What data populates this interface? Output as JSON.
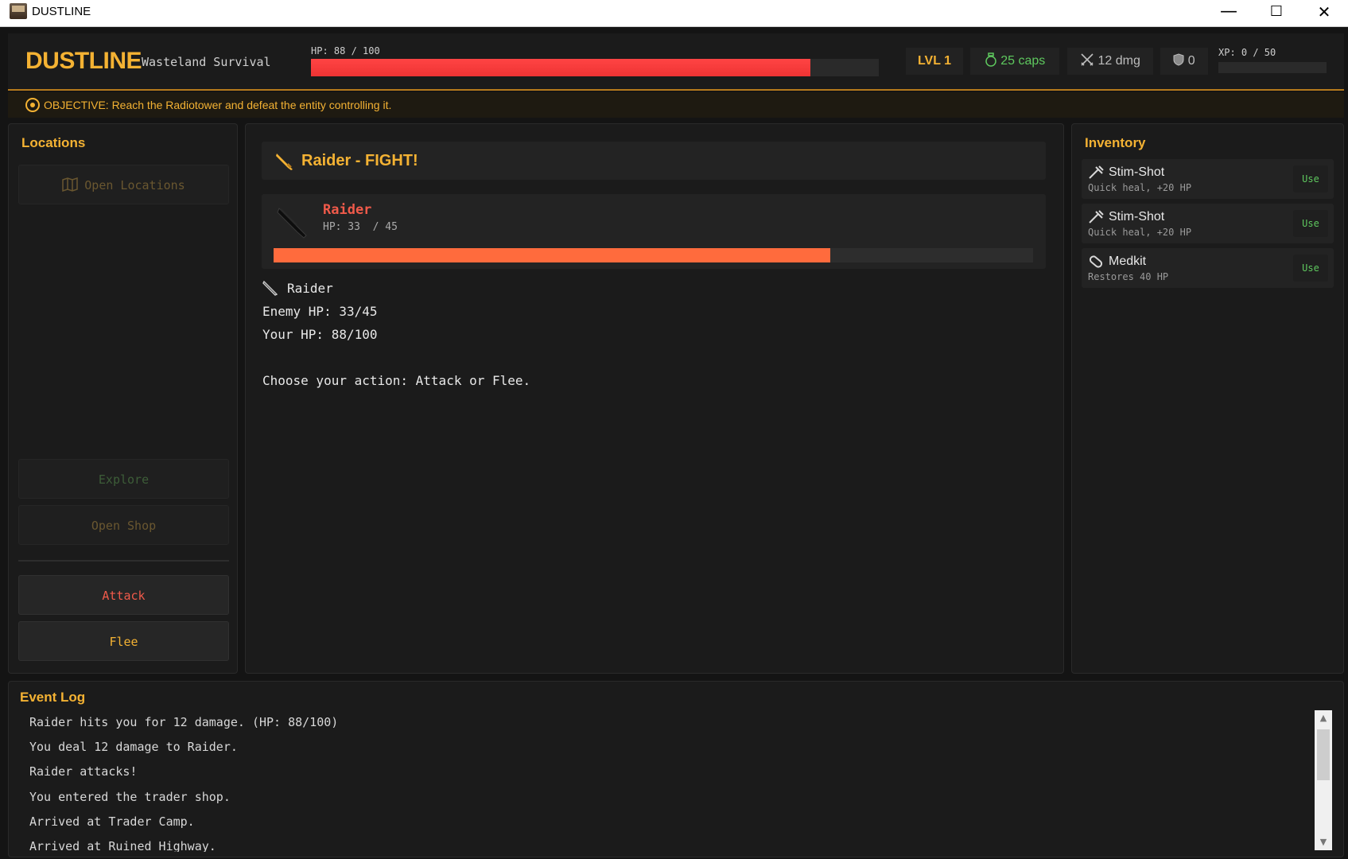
{
  "window": {
    "title": "DUSTLINE",
    "minimize": "—",
    "maximize": "☐",
    "close": "✕"
  },
  "header": {
    "logo": "DUSTLINE",
    "subtitle": "Wasteland Survival",
    "hp_label": "HP: 88 / 100",
    "hp_fraction": 0.88,
    "level": "LVL 1",
    "caps": "25 caps",
    "damage": "12 dmg",
    "armor": "0",
    "xp_label": "XP: 0 / 50",
    "xp_fraction": 0
  },
  "objective": {
    "text": "OBJECTIVE: Reach the Radiotower and defeat the entity controlling it."
  },
  "locations": {
    "title": "Locations",
    "open_locations": "Open Locations",
    "explore": "Explore",
    "open_shop": "Open Shop",
    "attack": "Attack",
    "flee": "Flee"
  },
  "fight": {
    "title": "Raider - FIGHT!",
    "enemy_name": "Raider",
    "enemy_hp_label": "HP: 33  / 45",
    "enemy_hp_fraction": 0.733,
    "lines": [
      "Raider",
      "Enemy HP: 33/45",
      "Your HP: 88/100",
      "",
      "Choose your action: Attack or Flee."
    ]
  },
  "inventory": {
    "title": "Inventory",
    "items": [
      {
        "name": "Stim-Shot",
        "desc": "Quick heal, +20 HP",
        "use": "Use",
        "icon": "syringe-icon"
      },
      {
        "name": "Stim-Shot",
        "desc": "Quick heal, +20 HP",
        "use": "Use",
        "icon": "syringe-icon"
      },
      {
        "name": "Medkit",
        "desc": "Restores 40 HP",
        "use": "Use",
        "icon": "bandage-icon"
      }
    ]
  },
  "log": {
    "title": "Event Log",
    "lines": [
      "Raider hits you for 12 damage. (HP: 88/100)",
      "You deal 12 damage to Raider.",
      "Raider attacks!",
      "You entered the trader shop.",
      "Arrived at Trader Camp.",
      "Arrived at Ruined Highway."
    ]
  },
  "colors": {
    "accent": "#f4b233",
    "danger": "#f05a4a",
    "hp_bar": "#ee3c3c",
    "enemy_bar": "#ff6b3d",
    "caps": "#5ec85e"
  }
}
